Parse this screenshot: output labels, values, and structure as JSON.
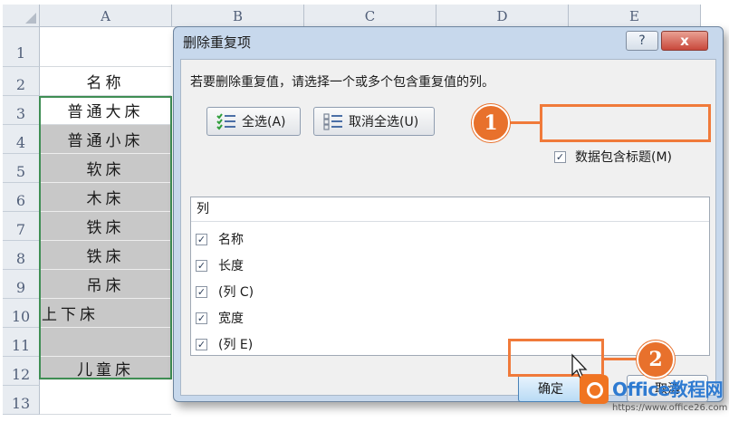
{
  "spreadsheet": {
    "columns": [
      "A",
      "B",
      "C",
      "D",
      "E"
    ],
    "rows": [
      "1",
      "2",
      "3",
      "4",
      "5",
      "6",
      "7",
      "8",
      "9",
      "10",
      "11",
      "12",
      "13"
    ],
    "colA": [
      "",
      "名称",
      "普通大床",
      "普通小床",
      "软床",
      "木床",
      "铁床",
      "铁床",
      "吊床",
      "上下床",
      "",
      "儿童床",
      ""
    ]
  },
  "dialog": {
    "title": "删除重复项",
    "help_label": "?",
    "close_label": "x",
    "instruction": "若要删除重复值，请选择一个或多个包含重复值的列。",
    "select_all_label": "全选(A)",
    "unselect_all_label": "取消全选(U)",
    "header_checkbox_label": "数据包含标题(M)",
    "header_checked": true,
    "list_header": "列",
    "columns": [
      {
        "label": "名称",
        "checked": true
      },
      {
        "label": "长度",
        "checked": true
      },
      {
        "label": "(列 C)",
        "checked": true
      },
      {
        "label": "宽度",
        "checked": true
      },
      {
        "label": "(列 E)",
        "checked": true
      }
    ],
    "ok_label": "确定",
    "cancel_label": "取消"
  },
  "annotations": {
    "callout_1": "1",
    "callout_2": "2",
    "accent_color": "#f07a3a"
  },
  "watermark": {
    "name": "Office教程网",
    "url": "https://www.office26.com"
  }
}
